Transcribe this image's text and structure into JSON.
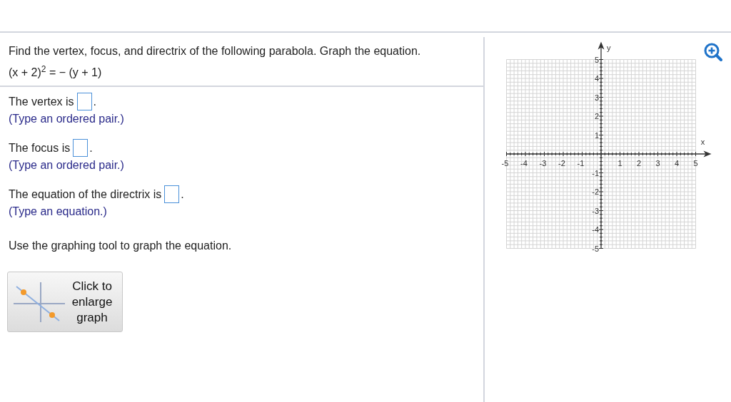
{
  "question": {
    "instruction": "Find the vertex, focus, and directrix of the following parabola. Graph the equation.",
    "equation": "(x + 2)$^{2}$ = − (y + 1)"
  },
  "parts": [
    {
      "label": "The vertex is",
      "end": ".",
      "hint": "(Type an ordered pair.)"
    },
    {
      "label": "The focus is",
      "end": ".",
      "hint": "(Type an ordered pair.)"
    },
    {
      "label": "The equation of the directrix is",
      "end": ".",
      "hint": "(Type an equation.)"
    }
  ],
  "graph_instruction": "Use the graphing tool to graph the equation.",
  "enlarge_button": {
    "label": "Click to enlarge graph"
  },
  "graph": {
    "x_label": "x",
    "y_label": "y",
    "x_ticks": [
      "-5",
      "-4",
      "-3",
      "-2",
      "-1",
      "1",
      "2",
      "3",
      "4",
      "5"
    ],
    "y_ticks": [
      "5",
      "4",
      "3",
      "2",
      "1",
      "-1",
      "-2",
      "-3",
      "-4",
      "-5"
    ]
  }
}
